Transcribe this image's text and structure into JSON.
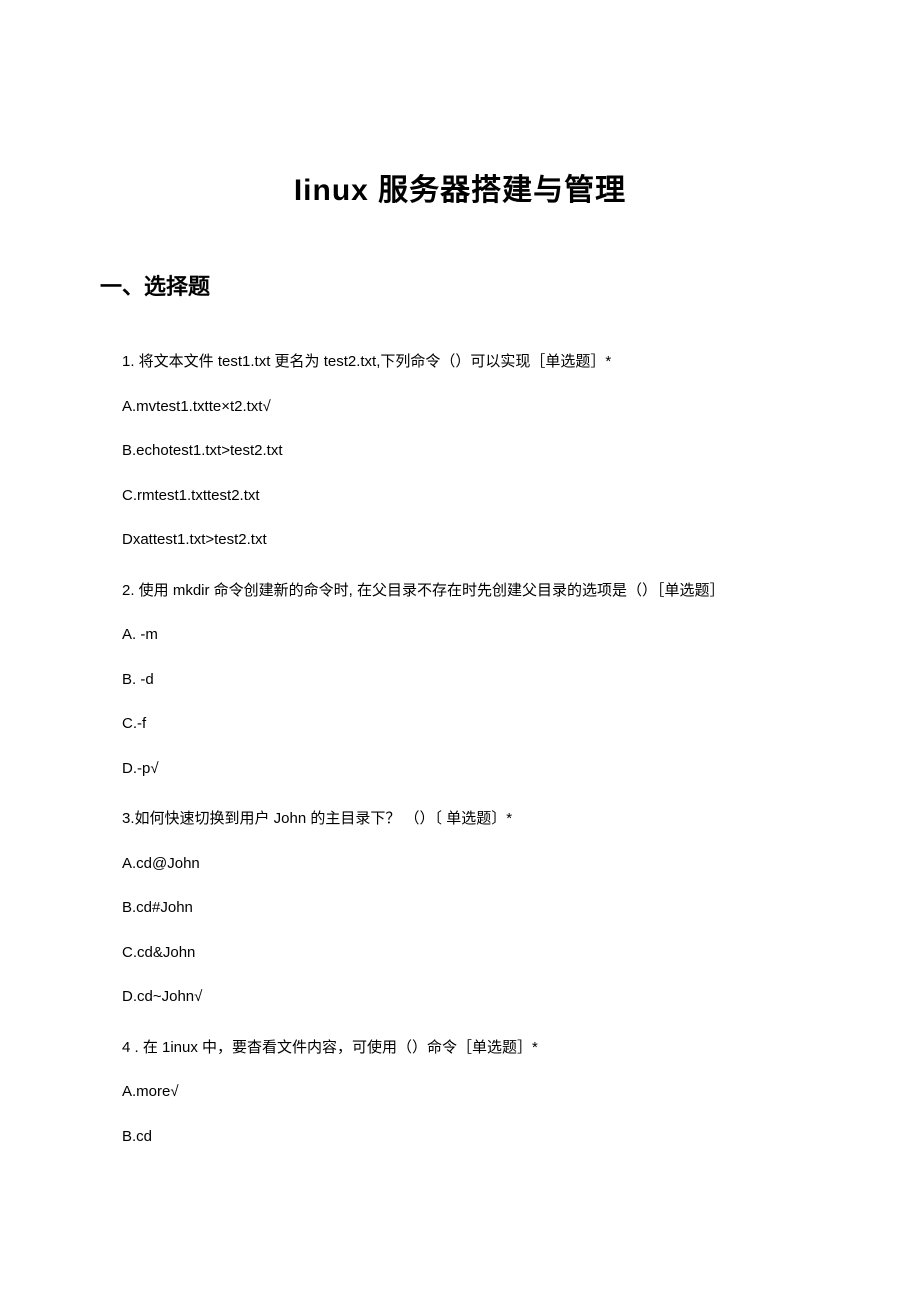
{
  "title": "Iinux 服务器搭建与管理",
  "section_header": "一、选择题",
  "questions": [
    {
      "prompt": "1. 将文本文件 test1.txt 更名为 test2.txt,下列命令（）可以实现［单选题］*",
      "options": [
        "A.mvtest1.txtte×t2.txt√",
        "B.echotest1.txt>test2.txt",
        "C.rmtest1.txttest2.txt",
        "Dxattest1.txt>test2.txt"
      ]
    },
    {
      "prompt": "2. 使用 mkdir 命令创建新的命令时, 在父目录不存在时先创建父目录的选项是（）［单选题］",
      "options": [
        "A.   -m",
        "B.   -d",
        "C.-f",
        "D.-p√"
      ]
    },
    {
      "prompt": "3.如何快速切换到用户 John 的主目录下？ （）〔 单选题〕*",
      "options": [
        "A.cd@John",
        "B.cd#John",
        "C.cd&John",
        "D.cd~John√"
      ]
    },
    {
      "prompt": "4   . 在 1inux 中，要杳看文件内容，可使用（）命令［单选题］*",
      "options": [
        "A.more√",
        "B.cd"
      ]
    }
  ]
}
